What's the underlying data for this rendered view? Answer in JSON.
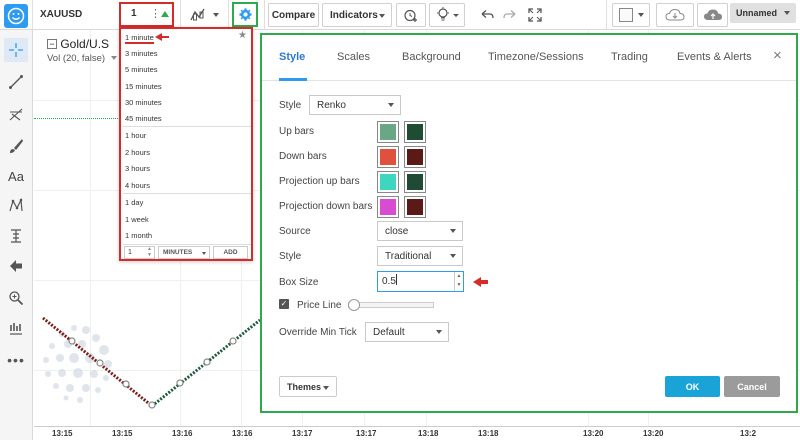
{
  "toolbar": {
    "symbol": "XAUUSD",
    "interval_value": "1",
    "compare_label": "Compare",
    "indicators_label": "Indicators",
    "layout_name": "Unnamed"
  },
  "chart": {
    "legend_title": "Gold/U.S",
    "legend_indicator": "Vol (20, false)",
    "time_labels": [
      "13:15",
      "13:15",
      "13:16",
      "13:16",
      "13:17",
      "13:17",
      "13:18",
      "13:18",
      "13:20",
      "13:20",
      "13:2"
    ]
  },
  "interval_dropdown": {
    "groups": [
      [
        "1 minute",
        "3 minutes",
        "5 minutes",
        "15 minutes",
        "30 minutes",
        "45 minutes"
      ],
      [
        "1 hour",
        "2 hours",
        "3 hours",
        "4 hours"
      ],
      [
        "1 day",
        "1 week",
        "1 month"
      ]
    ],
    "selected": "1 minute",
    "custom_value": "1",
    "custom_unit": "MINUTES",
    "add_label": "ADD"
  },
  "dialog": {
    "tabs": [
      "Style",
      "Scales",
      "Background",
      "Timezone/Sessions",
      "Trading",
      "Events & Alerts"
    ],
    "active_tab": "Style",
    "style_label": "Style",
    "style_value": "Renko",
    "up_bars_label": "Up bars",
    "down_bars_label": "Down bars",
    "projection_up_label": "Projection up bars",
    "projection_down_label": "Projection down bars",
    "source_label": "Source",
    "source_value": "close",
    "box_style_label": "Style",
    "box_style_value": "Traditional",
    "box_size_label": "Box Size",
    "box_size_value": "0.5",
    "price_line_label": "Price Line",
    "override_label": "Override Min Tick",
    "override_value": "Default",
    "themes_label": "Themes",
    "ok_label": "OK",
    "cancel_label": "Cancel"
  },
  "colors": {
    "up_bars": [
      "#6aa784",
      "#1e4d33"
    ],
    "down_bars": [
      "#e0503f",
      "#5c1a17"
    ],
    "projection_up": [
      "#3fd6c0",
      "#1f4a35"
    ],
    "projection_down": [
      "#d94bd1",
      "#5c1a17"
    ],
    "dialog_highlight": "#2eaa4c",
    "dropdown_highlight": "#d62b2b",
    "ok_button": "#1aa3d6",
    "cancel_button": "#9b9b9b"
  }
}
